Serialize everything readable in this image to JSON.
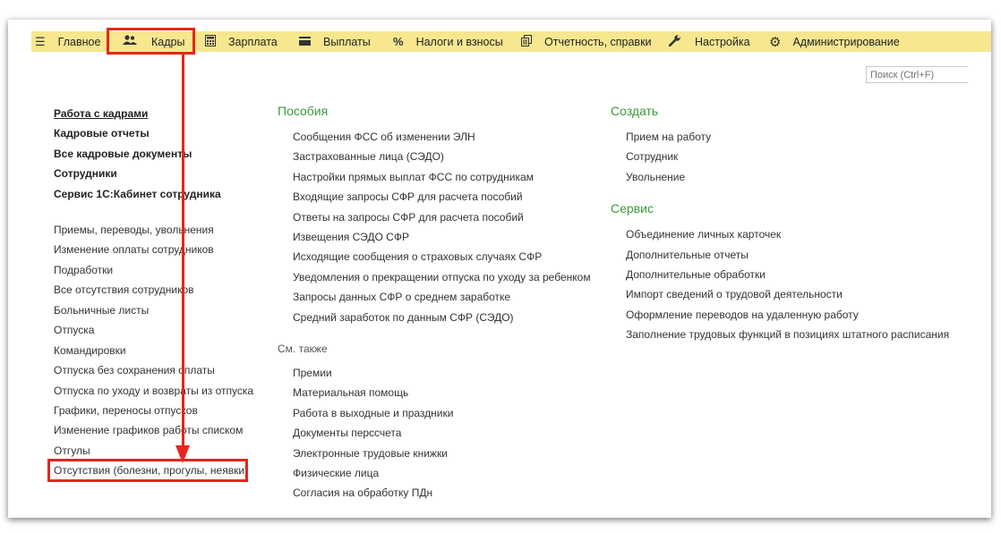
{
  "menu": {
    "items": [
      {
        "label": "Главное",
        "icon": "hamburger-icon"
      },
      {
        "label": "Кадры",
        "icon": "users-icon"
      },
      {
        "label": "Зарплата",
        "icon": "calculator-icon"
      },
      {
        "label": "Выплаты",
        "icon": "wallet-icon"
      },
      {
        "label": "Налоги и взносы",
        "icon": "percent-icon"
      },
      {
        "label": "Отчетность, справки",
        "icon": "documents-icon"
      },
      {
        "label": "Настройка",
        "icon": "wrench-icon"
      },
      {
        "label": "Администрирование",
        "icon": "gear-icon"
      }
    ],
    "accent": "#f7e78f"
  },
  "search": {
    "placeholder": "Поиск (Ctrl+F)"
  },
  "left": {
    "primary": [
      "Работа с кадрами",
      "Кадровые отчеты",
      "Все кадровые документы",
      "Сотрудники",
      "Сервис 1С:Кабинет сотрудника"
    ],
    "secondary": [
      "Приемы, переводы, увольнения",
      "Изменение оплаты сотрудников",
      "Подработки",
      "Все отсутствия сотрудников",
      "Больничные листы",
      "Отпуска",
      "Командировки",
      "Отпуска без сохранения оплаты",
      "Отпуска по уходу и возвраты из отпуска",
      "Графики, переносы отпусков",
      "Изменение графиков работы списком",
      "Отгулы",
      "Отсутствия (болезни, прогулы, неявки)"
    ]
  },
  "middle": {
    "title": "Пособия",
    "items": [
      "Сообщения ФСС об изменении ЭЛН",
      "Застрахованные лица (СЭДО)",
      "Настройки прямых выплат ФСС по сотрудникам",
      "Входящие запросы СФР для расчета пособий",
      "Ответы на запросы СФР для расчета пособий",
      "Извещения СЭДО СФР",
      "Исходящие сообщения о страховых случаях СФР",
      "Уведомления о прекращении отпуска по уходу за ребенком",
      "Запросы данных СФР о среднем заработке",
      "Средний заработок по данным СФР (СЭДО)"
    ],
    "see_also_title": "См. также",
    "see_also": [
      "Премии",
      "Материальная помощь",
      "Работа в выходные и праздники",
      "Документы перссчета",
      "Электронные трудовые книжки",
      "Физические лица",
      "Согласия на обработку ПДн"
    ]
  },
  "right": {
    "create_title": "Создать",
    "create": [
      "Прием на работу",
      "Сотрудник",
      "Увольнение"
    ],
    "service_title": "Сервис",
    "service": [
      "Объединение личных карточек",
      "Дополнительные отчеты",
      "Дополнительные обработки",
      "Импорт сведений о трудовой деятельности",
      "Оформление переводов на удаленную работу",
      "Заполнение трудовых функций в позициях штатного расписания"
    ]
  },
  "colors": {
    "annotation": "#e4261d",
    "section": "#3a9a3a"
  }
}
